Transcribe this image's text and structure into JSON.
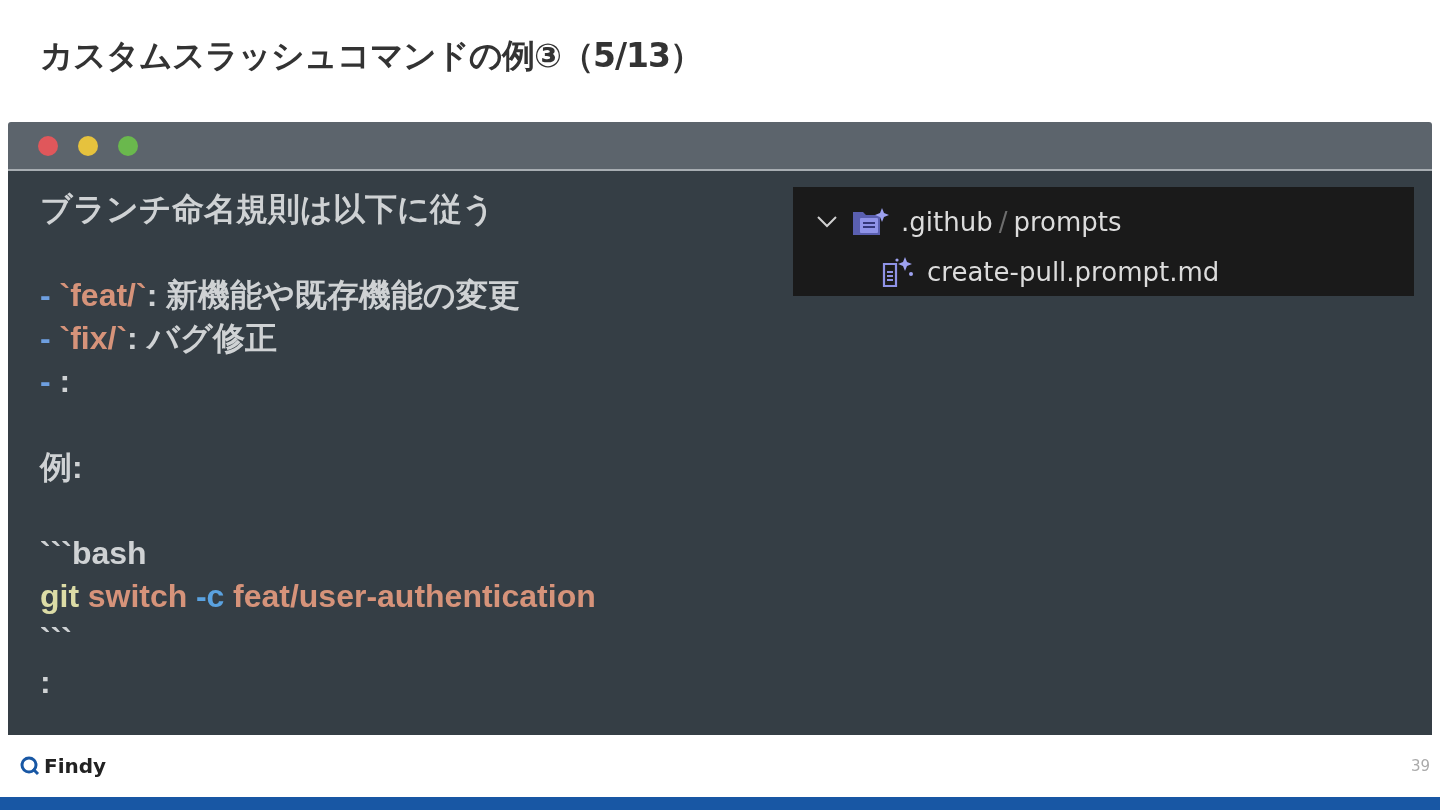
{
  "slide": {
    "title": "カスタムスラッシュコマンドの例③（5/13）",
    "page_number": "39"
  },
  "window": {
    "buttons": [
      {
        "color": "#e0575b"
      },
      {
        "color": "#e6c23d"
      },
      {
        "color": "#6ab84d"
      }
    ],
    "lines": [
      {
        "kind": "text",
        "segments": [
          {
            "kind": "plain",
            "text": "ブランチ命名規則は以下に従う"
          }
        ]
      },
      {
        "kind": "blank"
      },
      {
        "kind": "text",
        "segments": [
          {
            "kind": "bullet",
            "text": "- "
          },
          {
            "kind": "string",
            "text": "`feat/`"
          },
          {
            "kind": "plain",
            "text": ": 新機能や既存機能の変更"
          }
        ]
      },
      {
        "kind": "text",
        "segments": [
          {
            "kind": "bullet",
            "text": "- "
          },
          {
            "kind": "string",
            "text": "`fix/`"
          },
          {
            "kind": "plain",
            "text": ": バグ修正"
          }
        ]
      },
      {
        "kind": "text",
        "segments": [
          {
            "kind": "bullet",
            "text": "- "
          },
          {
            "kind": "plain",
            "text": ":"
          }
        ]
      },
      {
        "kind": "blank"
      },
      {
        "kind": "text",
        "segments": [
          {
            "kind": "plain",
            "text": "例:"
          }
        ]
      },
      {
        "kind": "blank"
      },
      {
        "kind": "text",
        "segments": [
          {
            "kind": "plain",
            "text": "```bash"
          }
        ]
      },
      {
        "kind": "text",
        "segments": [
          {
            "kind": "command",
            "text": "git"
          },
          {
            "kind": "string",
            "text": "switch",
            "space_before": true
          },
          {
            "kind": "flag",
            "text": "-c",
            "space_before": true
          },
          {
            "kind": "string",
            "text": "feat/user-authentication",
            "space_before": true
          }
        ]
      },
      {
        "kind": "text",
        "segments": [
          {
            "kind": "plain",
            "text": "```"
          }
        ]
      },
      {
        "kind": "text",
        "segments": [
          {
            "kind": "plain",
            "text": ":"
          }
        ]
      }
    ]
  },
  "explorer": {
    "folder": {
      "expanded": true,
      "path_parent": ".github",
      "separator": "/",
      "path_child": "prompts",
      "children": [
        {
          "name": "create-pull.prompt.md"
        }
      ]
    }
  },
  "footer": {
    "logo": "Findy"
  }
}
